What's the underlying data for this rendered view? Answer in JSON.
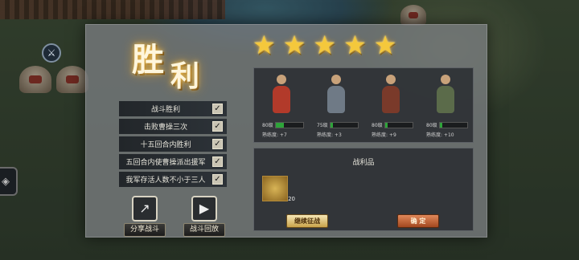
{
  "title_chars": [
    "胜",
    "利"
  ],
  "objectives": [
    {
      "label": "战斗胜利",
      "checked": true
    },
    {
      "label": "击败曹操三次",
      "checked": true
    },
    {
      "label": "十五回合内胜利",
      "checked": true
    },
    {
      "label": "五回合内使曹操派出援军",
      "checked": true
    },
    {
      "label": "我军存活人数不小于三人",
      "checked": true
    }
  ],
  "check_glyph": "✓",
  "actions": {
    "share_label": "分享战斗",
    "replay_label": "战斗回放"
  },
  "stars": {
    "count": 5,
    "glyph": "★"
  },
  "heroes": [
    {
      "level": "80级",
      "exp_fraction": 0.3,
      "proficiency": "熟练度: +7",
      "color": "#b23a2a"
    },
    {
      "level": "75级",
      "exp_fraction": 0.08,
      "proficiency": "熟练度: +3",
      "color": "#6f7a86"
    },
    {
      "level": "80级",
      "exp_fraction": 0.1,
      "proficiency": "熟练度: +9",
      "color": "#7a3a2a"
    },
    {
      "level": "80级",
      "exp_fraction": 0.1,
      "proficiency": "熟练度: +10",
      "color": "#5b6b4a"
    }
  ],
  "loot": {
    "title": "战利品",
    "item_count": "20",
    "continue_label": "继续征战",
    "confirm_label": "确 定"
  },
  "colors": {
    "accent_gold": "#f4c83c",
    "exp_green": "#2ea43a"
  }
}
